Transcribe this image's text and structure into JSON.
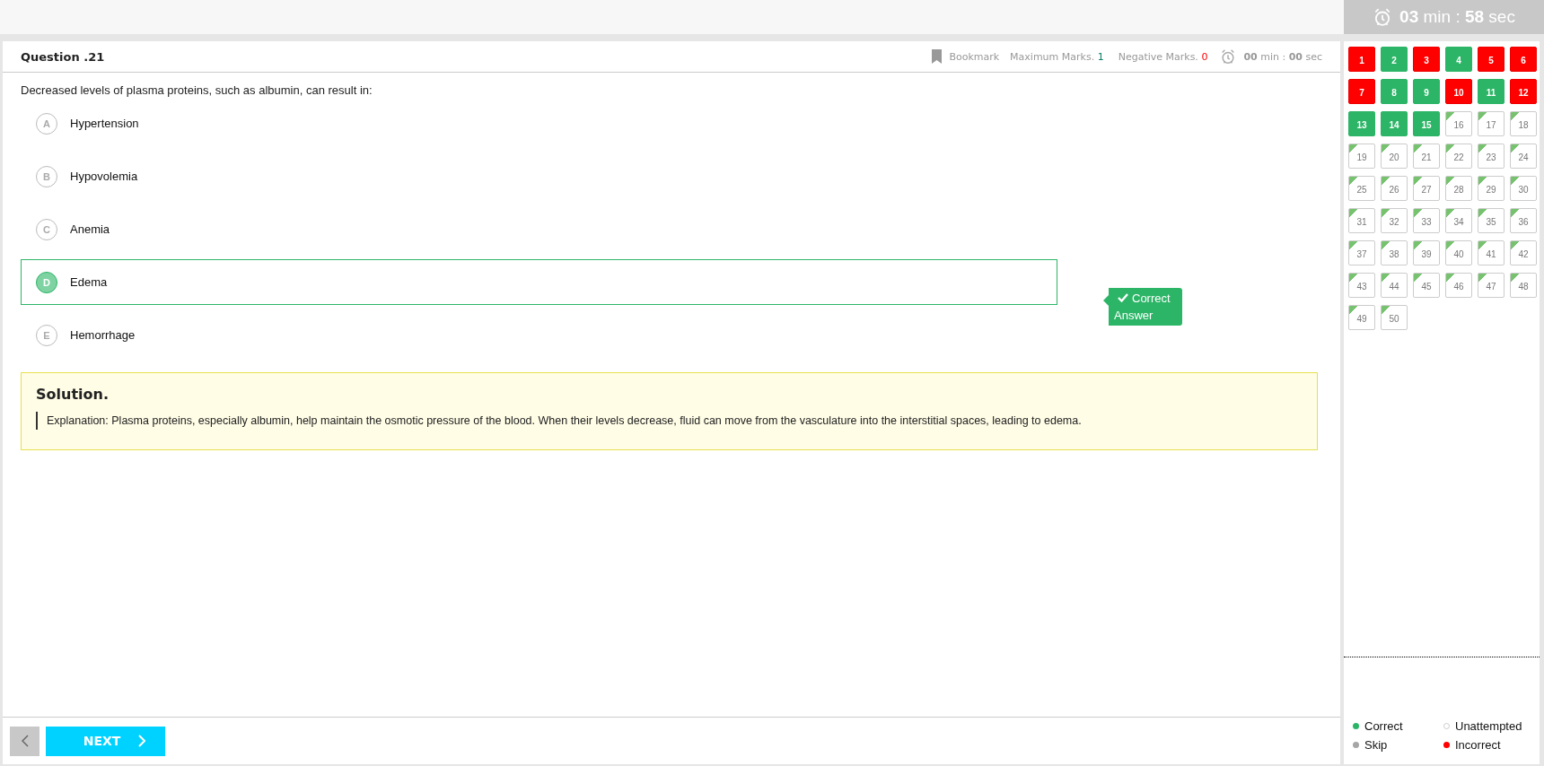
{
  "timer": {
    "minutes": "03",
    "min_label": "min :",
    "seconds": "58",
    "sec_label": "sec"
  },
  "question": {
    "title": "Question .21",
    "bookmark": "Bookmark",
    "max_marks_label": "Maximum Marks.",
    "max_marks": "1",
    "negative_marks_label": "Negative Marks.",
    "negative_marks": "0",
    "time": {
      "minutes": "00",
      "min_label": "min :",
      "seconds": "00",
      "sec_label": "sec"
    },
    "text": "Decreased levels of plasma proteins, such as albumin, can result in:",
    "options": [
      {
        "letter": "A",
        "label": "Hypertension",
        "selected": false,
        "correct": false
      },
      {
        "letter": "B",
        "label": "Hypovolemia",
        "selected": false,
        "correct": false
      },
      {
        "letter": "C",
        "label": "Anemia",
        "selected": false,
        "correct": false
      },
      {
        "letter": "D",
        "label": "Edema",
        "selected": true,
        "correct": true
      },
      {
        "letter": "E",
        "label": "Hemorrhage",
        "selected": false,
        "correct": false
      }
    ],
    "correct_badge": "Correct Answer",
    "solution": {
      "title": "Solution.",
      "text": "Explanation: Plasma proteins, especially albumin, help maintain the osmotic pressure of the blood. When their levels decrease, fluid can move from the vasculature into the interstitial spaces, leading to edema."
    }
  },
  "footer": {
    "next_button": "NEXT"
  },
  "palette": [
    {
      "number": "1",
      "kind": "incorrect"
    },
    {
      "number": "2",
      "kind": "correct"
    },
    {
      "number": "3",
      "kind": "incorrect"
    },
    {
      "number": "4",
      "kind": "correct"
    },
    {
      "number": "5",
      "kind": "incorrect"
    },
    {
      "number": "6",
      "kind": "incorrect"
    },
    {
      "number": "7",
      "kind": "incorrect"
    },
    {
      "number": "8",
      "kind": "correct"
    },
    {
      "number": "9",
      "kind": "correct"
    },
    {
      "number": "10",
      "kind": "incorrect"
    },
    {
      "number": "11",
      "kind": "correct"
    },
    {
      "number": "12",
      "kind": "incorrect"
    },
    {
      "number": "13",
      "kind": "correct"
    },
    {
      "number": "14",
      "kind": "correct"
    },
    {
      "number": "15",
      "kind": "correct"
    },
    {
      "number": "16",
      "kind": "unattempted"
    },
    {
      "number": "17",
      "kind": "unattempted"
    },
    {
      "number": "18",
      "kind": "unattempted"
    },
    {
      "number": "19",
      "kind": "unattempted"
    },
    {
      "number": "20",
      "kind": "unattempted"
    },
    {
      "number": "21",
      "kind": "unattempted"
    },
    {
      "number": "22",
      "kind": "unattempted"
    },
    {
      "number": "23",
      "kind": "unattempted"
    },
    {
      "number": "24",
      "kind": "unattempted"
    },
    {
      "number": "25",
      "kind": "unattempted"
    },
    {
      "number": "26",
      "kind": "unattempted"
    },
    {
      "number": "27",
      "kind": "unattempted"
    },
    {
      "number": "28",
      "kind": "unattempted"
    },
    {
      "number": "29",
      "kind": "unattempted"
    },
    {
      "number": "30",
      "kind": "unattempted"
    },
    {
      "number": "31",
      "kind": "unattempted"
    },
    {
      "number": "32",
      "kind": "unattempted"
    },
    {
      "number": "33",
      "kind": "unattempted"
    },
    {
      "number": "34",
      "kind": "unattempted"
    },
    {
      "number": "35",
      "kind": "unattempted"
    },
    {
      "number": "36",
      "kind": "unattempted"
    },
    {
      "number": "37",
      "kind": "unattempted"
    },
    {
      "number": "38",
      "kind": "unattempted"
    },
    {
      "number": "39",
      "kind": "unattempted"
    },
    {
      "number": "40",
      "kind": "unattempted"
    },
    {
      "number": "41",
      "kind": "unattempted"
    },
    {
      "number": "42",
      "kind": "unattempted"
    },
    {
      "number": "43",
      "kind": "unattempted"
    },
    {
      "number": "44",
      "kind": "unattempted"
    },
    {
      "number": "45",
      "kind": "unattempted"
    },
    {
      "number": "46",
      "kind": "unattempted"
    },
    {
      "number": "47",
      "kind": "unattempted"
    },
    {
      "number": "48",
      "kind": "unattempted"
    },
    {
      "number": "49",
      "kind": "unattempted"
    },
    {
      "number": "50",
      "kind": "unattempted"
    }
  ],
  "legend": [
    {
      "label": "Correct",
      "color": "#2db567",
      "kind": "filled"
    },
    {
      "label": "Unattempted",
      "color": "#cccccc",
      "kind": "hollow"
    },
    {
      "label": "Skip",
      "color": "#a6a6a6",
      "kind": "filled"
    },
    {
      "label": "Incorrect",
      "color": "#ff0000",
      "kind": "filled"
    }
  ]
}
